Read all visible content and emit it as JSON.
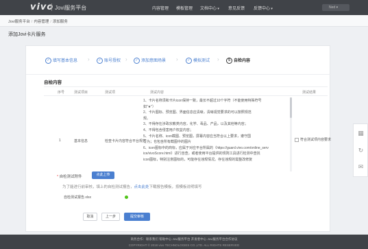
{
  "header": {
    "logo": "vivo",
    "brand": "Jovi服务平台",
    "nav": [
      "内容管理",
      "模板管理",
      "文档中心",
      "意见反馈",
      "反馈中心"
    ],
    "user": "Ned"
  },
  "breadcrumb": [
    "Jovi服务平台",
    "内容管理",
    "添加服务"
  ],
  "page_title": "添加Jovi卡片服务",
  "steps": [
    "填写基本信息",
    "账号授权",
    "添加意图场景",
    "模拟测试",
    "自检内容"
  ],
  "section_title": "自检内容",
  "table": {
    "headers": [
      "序号",
      "测试项目",
      "测试项",
      "测试内容",
      "测试结果"
    ],
    "row": {
      "index": "1",
      "category": "基本信息",
      "item": "检查卡片内容符合平台规范",
      "content_lines": [
        "1、卡片名称须和卡片icon保持一致，最长不超过10个字符（不能使用特殊符号",
        "如\"★\"）",
        "2、卡片图标、预览图、界面信息应清晰，清晰视觉要求的可以按照规范",
        "规。",
        "3、不得存在涉政宗教类内容，化学、毒品、产品，以及其他等内容；",
        "4、不得包含侵害用户权益内容；",
        "5、卡片名称、icon截图、预览图，屏幕内容应当符合以上要求，遵守国",
        "行为；也包含所有截图中的图片",
        "6、icon图标中的商标，应属于对应平台所属的（https://guard.vivo.com/online_serv",
        "ice/vivoScore.html）进行自查，或者使用平台提供的规则工具进行检测中查找",
        "icon图标，特别注意图标的，可能存在违规情况。存在违规的需整改修复"
      ],
      "result_label": "符合测试项内容要求"
    }
  },
  "upload": {
    "label": "自检测试附件",
    "button": "点此上传",
    "hint_before": "为了能进行前审核，填上的自检测试报告，",
    "hint_link": "点击此处",
    "hint_after": "下载报告模板，按模板说明填写",
    "filename": "自检测试报告.xlsx"
  },
  "buttons": {
    "cancel": "取消",
    "prev": "上一步",
    "submit": "提交审核"
  },
  "footer": {
    "line1": "商务合作：联系我们  帮助中心  Jovi服务平台  开发者中心  Jovi服务平台合作协议",
    "line2": "COPYRIGHT © 2018 vivo TECHNOLOGIES CO.,LTD. ALL RIGHTS RESERVED"
  },
  "colors": {
    "accent": "#4a7fd0",
    "topbar": "#404348",
    "success": "#52c41a"
  }
}
